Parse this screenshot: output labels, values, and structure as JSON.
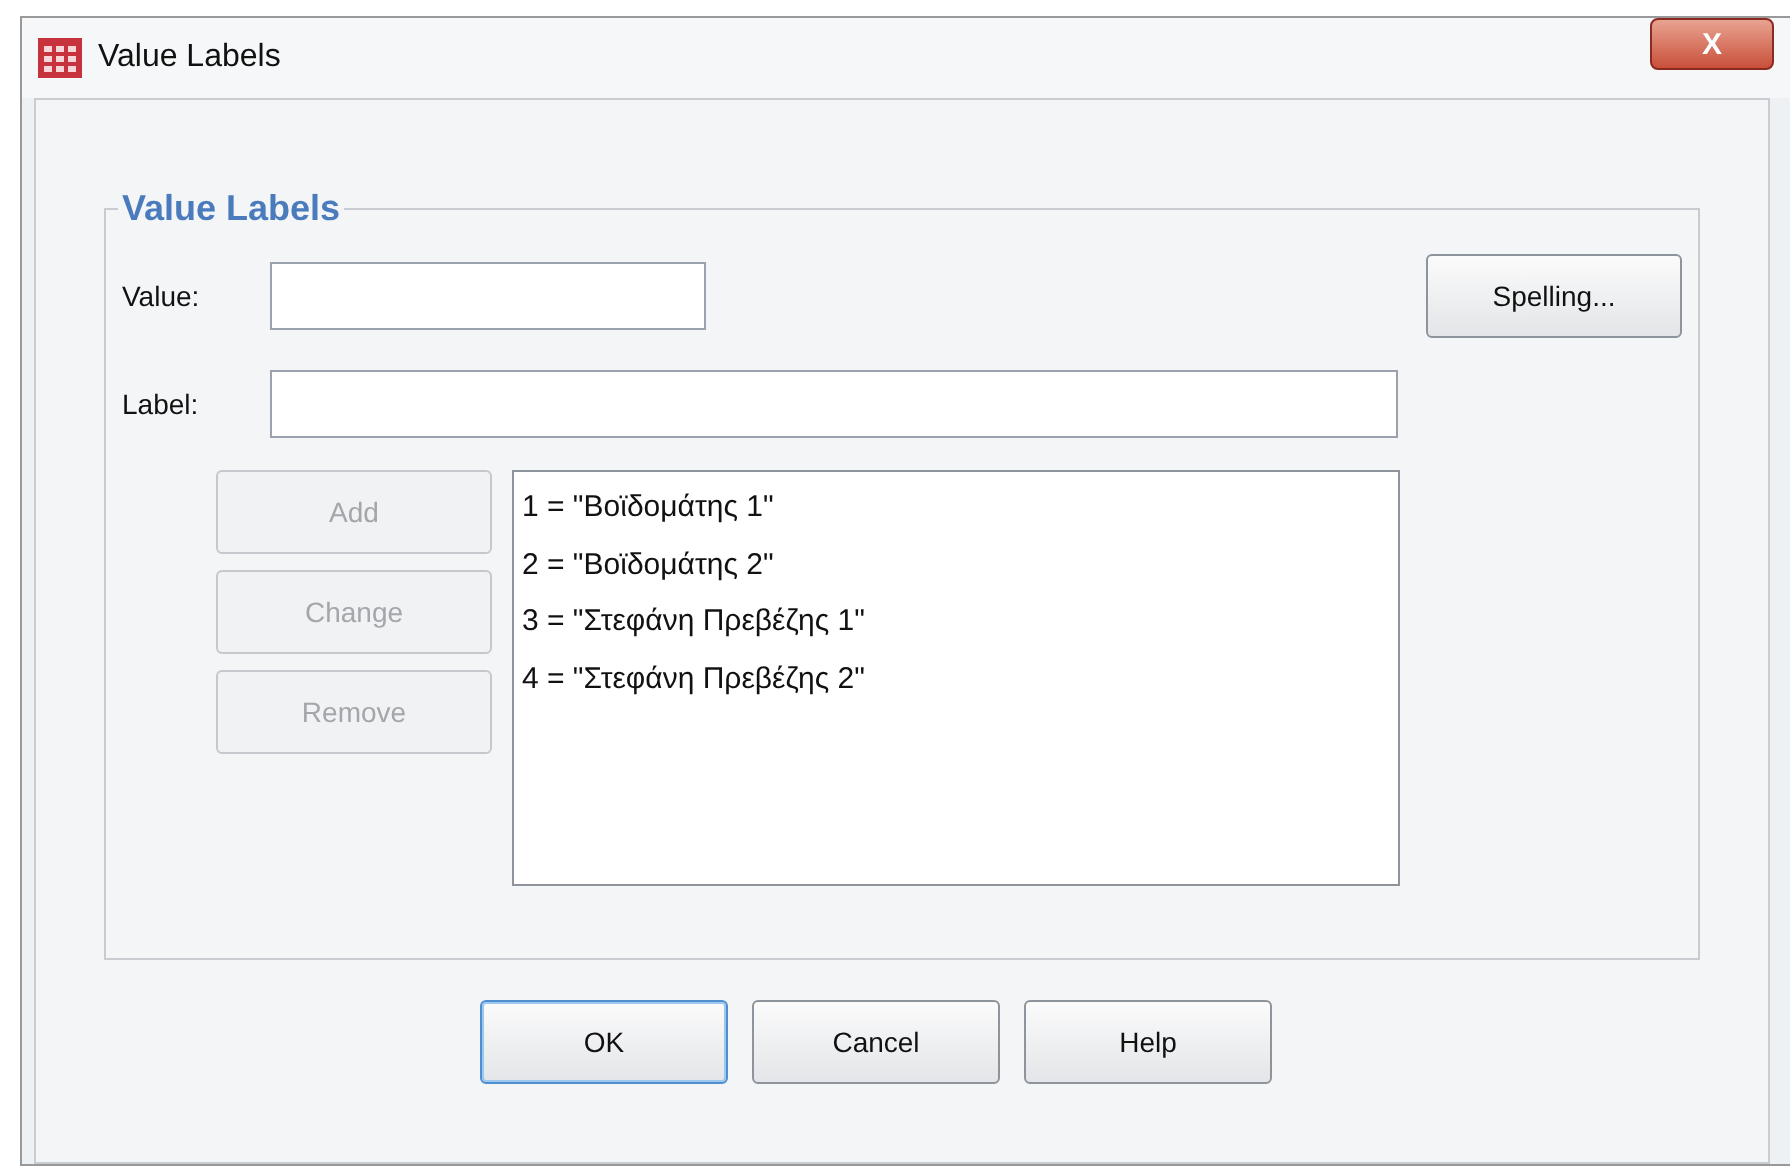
{
  "window": {
    "title": "Value Labels",
    "close": "X"
  },
  "group": {
    "title": "Value Labels"
  },
  "value_field": {
    "label": "Value:"
  },
  "label_field": {
    "label": "Label:"
  },
  "side_buttons": [
    {
      "label": "Spelling...",
      "disabled": false
    }
  ],
  "edit_buttons": [
    {
      "label": "Add",
      "disabled": true
    },
    {
      "label": "Change",
      "disabled": true
    },
    {
      "label": "Remove",
      "disabled": true
    }
  ],
  "labels_list": [
    {
      "text": "1 = \"Βοϊδομάτης 1\"",
      "selected": false
    },
    {
      "text": "2 = \"Βοϊδομάτης 2\"",
      "selected": false
    },
    {
      "text": "3 = \"Στεφάνη Πρεβέζης 1\"",
      "selected": false
    },
    {
      "text": "4 = \"Στεφάνη Πρεβέζης 2\"",
      "selected": false
    }
  ],
  "buttons": [
    {
      "label": "OK",
      "default": true
    },
    {
      "label": "Cancel",
      "default": false
    },
    {
      "label": "Help",
      "default": false
    }
  ]
}
